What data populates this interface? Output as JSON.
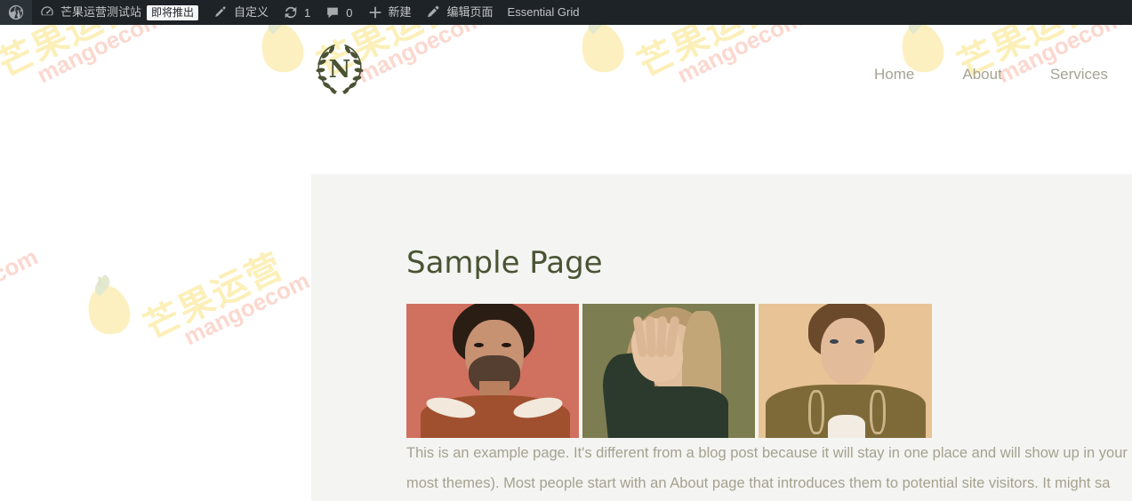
{
  "adminbar": {
    "items": [
      {
        "name": "wordpress-logo",
        "icon": "wordpress-icon",
        "label": ""
      },
      {
        "name": "site-name",
        "icon": "dashboard-icon",
        "label": "芒果运营测试站",
        "badge": "即将推出"
      },
      {
        "name": "customize",
        "icon": "brush-icon",
        "label": "自定义"
      },
      {
        "name": "updates",
        "icon": "update-icon",
        "label": "",
        "count": "1"
      },
      {
        "name": "comments",
        "icon": "comment-bubble-icon",
        "label": "",
        "count": "0"
      },
      {
        "name": "new-content",
        "icon": "plus-icon",
        "label": "新建"
      },
      {
        "name": "edit-page",
        "icon": "pencil-icon",
        "label": "编辑页面"
      },
      {
        "name": "essential-grid",
        "icon": "",
        "label": "Essential Grid"
      }
    ]
  },
  "header": {
    "logo_letter": "N",
    "logo_alt": "laurel-wreath-logo",
    "nav": [
      {
        "label": "Home"
      },
      {
        "label": "About"
      },
      {
        "label": "Services"
      }
    ]
  },
  "content": {
    "page_title": "Sample Page",
    "gallery": [
      {
        "alt": "portrait-man-coral-background"
      },
      {
        "alt": "portrait-woman-olive-background"
      },
      {
        "alt": "portrait-man-tan-background"
      }
    ],
    "paragraph_line_1": "This is an example page. It's different from a blog post because it will stay in one place and will show up in your",
    "paragraph_line_2": "most themes). Most people start with an About page that introduces them to potential site visitors. It might sa"
  },
  "watermark": {
    "cn_text": "芒果运营",
    "en_text": "mangoecom.com"
  },
  "colors": {
    "adminbar_bg": "#1d2327",
    "card_bg": "#f4f5f2",
    "title_color": "#4a5434",
    "nav_color": "#a6a393",
    "body_text_color": "#a5a190",
    "watermark_cn": "#fcefb8",
    "watermark_en": "#fbd8cf"
  }
}
